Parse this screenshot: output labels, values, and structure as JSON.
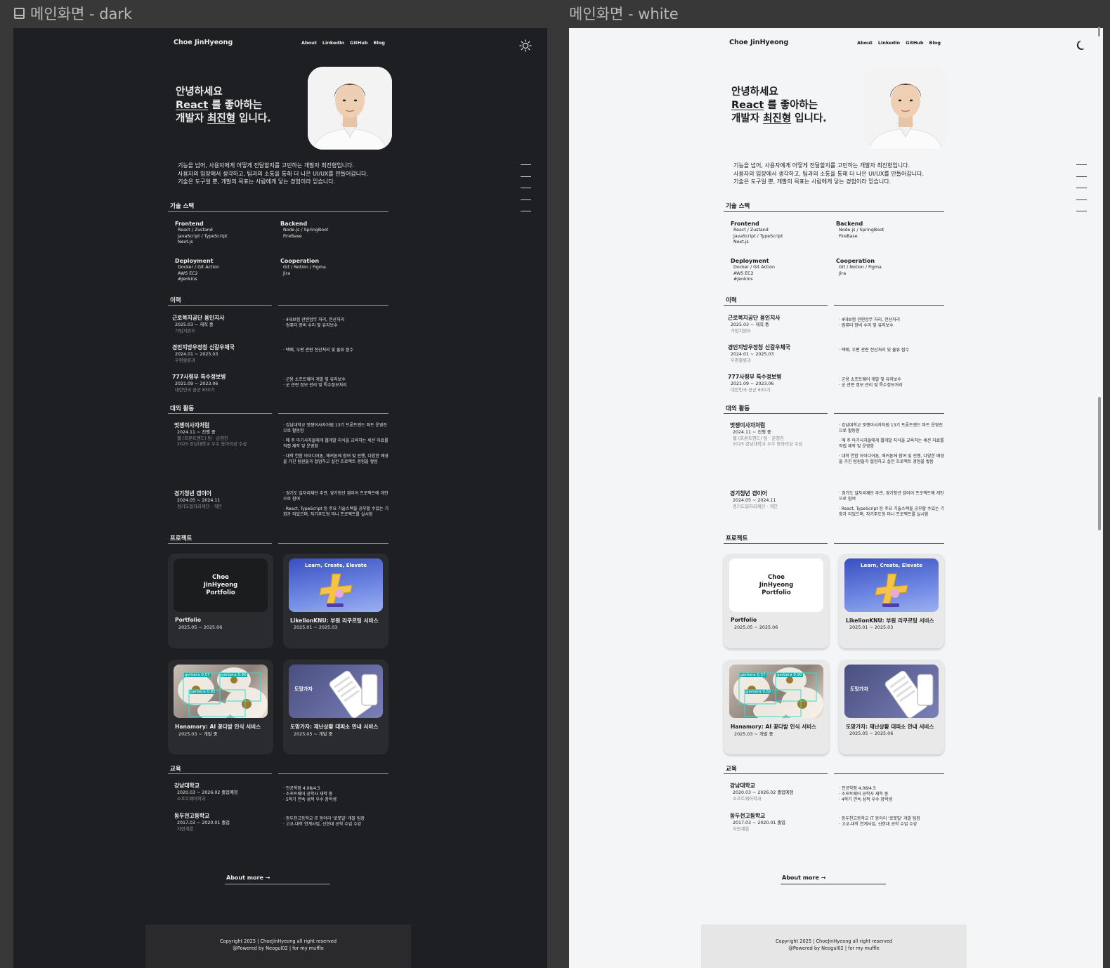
{
  "frames": {
    "dark_label": "메인화면 - dark",
    "white_label": "메인화면 - white"
  },
  "site": {
    "brand": "Choe JinHyeong",
    "nav": [
      "About",
      "LinkedIn",
      "GitHub",
      "Blog"
    ],
    "hero": {
      "line1": "안녕하세요",
      "line2_a": "React",
      "line2_b": " 를 좋아하는",
      "line3_a": "개발자 ",
      "line3_b": "최진형",
      "line3_c": " 입니다."
    },
    "intro": [
      "기능을 넘어, 사용자에게 어떻게 전달할지를 고민하는 개발자 최진형입니다.",
      "사용자의 입장에서 생각하고, 팀과의 소통을 통해 더 나은 UI/UX를 만들어갑니다.",
      "기술은 도구일 뿐, 개발의 목표는 사람에게 닿는 경험이라 믿습니다."
    ],
    "sections": {
      "skills": "기술 스택",
      "career": "이력",
      "activities": "대외 활동",
      "projects": "프로젝트",
      "education": "교육"
    },
    "skills": [
      {
        "title": "Frontend",
        "items": [
          "React / Zustand",
          "JavaScript / TypeScript",
          "Next.js"
        ]
      },
      {
        "title": "Backend",
        "items": [
          "Node.js / SpringBoot",
          "FireBase"
        ]
      },
      {
        "title": "Deployment",
        "items": [
          "Docker / Git Action",
          "AWS EC2",
          "#Jenkins"
        ]
      },
      {
        "title": "Cooperation",
        "items": [
          "Git / Notion / Figma",
          "Jira"
        ]
      }
    ],
    "career": [
      {
        "title": "근로복지공단 용인지사",
        "date": "2025.03 ~ 재직 중",
        "sub": "가입지원부",
        "desc": [
          "· 4대보험 관련업무 처리, 전산처리",
          "· 컴퓨터 장비 수리 및 유지보수"
        ]
      },
      {
        "title": "경인지방우정청 신갈우체국",
        "date": "2024.01 ~ 2025.03",
        "sub": "우편물류과",
        "desc": [
          "· 택배, 우편 관련 전산처리 및 물류 접수"
        ]
      },
      {
        "title": "777사령부 특수정보병",
        "date": "2021.09 ~ 2023.06",
        "sub": "대한민국 공군 830기",
        "desc": [
          "· 군용 소프트웨어 개발 및 유지보수",
          "· 군 관련 정보 관리 및 특수정보처리"
        ]
      }
    ],
    "activities": [
      {
        "title": "멋쟁이사자처럼",
        "date": "2024.11 ~ 진행 중",
        "sub": [
          "웹 (프론트엔드) 팀 · 운영진",
          "2025 강남대학교 우수 동아리상 수상"
        ],
        "desc": [
          "· 강남대학교 멋쟁이사자처럼 13기 프론트엔드 파트 운영진으로 활동함",
          "· 매 주 아기사자들에게 웹개발 지식을 교육하는 세션 자료를 직접 제작 및 운영함",
          "· 대학 연합 아이디어톤, 해커톤에 참여 및 진행, 다양한 배경을 가진 팀원들과 협업하고 실전 프로젝트 경험을 쌓음"
        ]
      },
      {
        "title": "경기청년 갭이어",
        "date": "2024.05 ~ 2024.11",
        "sub": [
          "경기도일자리재단 · 개인"
        ],
        "desc": [
          "· 경기도 일자리재단 주관, 경기청년 갭이어 프로젝트에 개인으로 참여",
          "· React, TypeScript 등 주요 기술스택을 공부할 수있는 기회가 되었으며, 자기주도형 미니 프로젝트를 실시함"
        ]
      }
    ],
    "projects": [
      {
        "title": "Portfolio",
        "date": "2025.05 ~ 2025.06",
        "thumb": "Choe JinHyeong Portfolio"
      },
      {
        "title": "LikelionKNU: 부원 리쿠르팅 서비스",
        "date": "2025.01 ~ 2025.03",
        "thumb": "Learn, Create, Elevate"
      },
      {
        "title": "Hanamory: AI 꽃다발 인식 서비스",
        "date": "2025.03 ~ 개발 중",
        "thumb": [
          "gerbera 0.57",
          "gerbera 0.90",
          "gerbera 0.82"
        ]
      },
      {
        "title": "도망가자: 재난상황 대피소 안내 서비스",
        "date": "2025.05 ~ 개발 중",
        "date_white": "2025.05 ~ 2025.06",
        "thumb": "도망가자"
      }
    ],
    "education": [
      {
        "title": "강남대학교",
        "date": "2020.03 ~ 2026.02 졸업예정",
        "sub": "소프트웨어학과",
        "desc": [
          "· 전공학점 4.08/4.5",
          "· 소프트웨어 공학사 재학 중",
          "· 5학기 연속 성적 우수 장학생"
        ],
        "desc_white3": "· 4학기 연속 성적 우수 장학생"
      },
      {
        "title": "동두천고등학교",
        "date": "2017.03 ~ 2020.01 졸업",
        "sub": "자연계열",
        "desc": [
          "· 동두천고등학교 IT 동아리 '로봇빌' 개발 팀장",
          "· 고교-대학 연계사업, 신한대 공학 수업 수강"
        ]
      }
    ],
    "about_more": "About more →",
    "footer": [
      "Copyright 2025 | ChoeJinHyeong all right reserved",
      "@Powered by Neogul02 | for my muffle"
    ]
  }
}
